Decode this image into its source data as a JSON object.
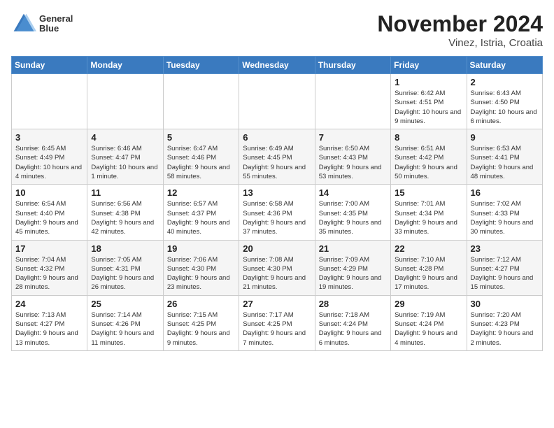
{
  "header": {
    "logo_line1": "General",
    "logo_line2": "Blue",
    "title": "November 2024",
    "subtitle": "Vinez, Istria, Croatia"
  },
  "weekdays": [
    "Sunday",
    "Monday",
    "Tuesday",
    "Wednesday",
    "Thursday",
    "Friday",
    "Saturday"
  ],
  "weeks": [
    [
      {
        "day": "",
        "info": ""
      },
      {
        "day": "",
        "info": ""
      },
      {
        "day": "",
        "info": ""
      },
      {
        "day": "",
        "info": ""
      },
      {
        "day": "",
        "info": ""
      },
      {
        "day": "1",
        "info": "Sunrise: 6:42 AM\nSunset: 4:51 PM\nDaylight: 10 hours and 9 minutes."
      },
      {
        "day": "2",
        "info": "Sunrise: 6:43 AM\nSunset: 4:50 PM\nDaylight: 10 hours and 6 minutes."
      }
    ],
    [
      {
        "day": "3",
        "info": "Sunrise: 6:45 AM\nSunset: 4:49 PM\nDaylight: 10 hours and 4 minutes."
      },
      {
        "day": "4",
        "info": "Sunrise: 6:46 AM\nSunset: 4:47 PM\nDaylight: 10 hours and 1 minute."
      },
      {
        "day": "5",
        "info": "Sunrise: 6:47 AM\nSunset: 4:46 PM\nDaylight: 9 hours and 58 minutes."
      },
      {
        "day": "6",
        "info": "Sunrise: 6:49 AM\nSunset: 4:45 PM\nDaylight: 9 hours and 55 minutes."
      },
      {
        "day": "7",
        "info": "Sunrise: 6:50 AM\nSunset: 4:43 PM\nDaylight: 9 hours and 53 minutes."
      },
      {
        "day": "8",
        "info": "Sunrise: 6:51 AM\nSunset: 4:42 PM\nDaylight: 9 hours and 50 minutes."
      },
      {
        "day": "9",
        "info": "Sunrise: 6:53 AM\nSunset: 4:41 PM\nDaylight: 9 hours and 48 minutes."
      }
    ],
    [
      {
        "day": "10",
        "info": "Sunrise: 6:54 AM\nSunset: 4:40 PM\nDaylight: 9 hours and 45 minutes."
      },
      {
        "day": "11",
        "info": "Sunrise: 6:56 AM\nSunset: 4:38 PM\nDaylight: 9 hours and 42 minutes."
      },
      {
        "day": "12",
        "info": "Sunrise: 6:57 AM\nSunset: 4:37 PM\nDaylight: 9 hours and 40 minutes."
      },
      {
        "day": "13",
        "info": "Sunrise: 6:58 AM\nSunset: 4:36 PM\nDaylight: 9 hours and 37 minutes."
      },
      {
        "day": "14",
        "info": "Sunrise: 7:00 AM\nSunset: 4:35 PM\nDaylight: 9 hours and 35 minutes."
      },
      {
        "day": "15",
        "info": "Sunrise: 7:01 AM\nSunset: 4:34 PM\nDaylight: 9 hours and 33 minutes."
      },
      {
        "day": "16",
        "info": "Sunrise: 7:02 AM\nSunset: 4:33 PM\nDaylight: 9 hours and 30 minutes."
      }
    ],
    [
      {
        "day": "17",
        "info": "Sunrise: 7:04 AM\nSunset: 4:32 PM\nDaylight: 9 hours and 28 minutes."
      },
      {
        "day": "18",
        "info": "Sunrise: 7:05 AM\nSunset: 4:31 PM\nDaylight: 9 hours and 26 minutes."
      },
      {
        "day": "19",
        "info": "Sunrise: 7:06 AM\nSunset: 4:30 PM\nDaylight: 9 hours and 23 minutes."
      },
      {
        "day": "20",
        "info": "Sunrise: 7:08 AM\nSunset: 4:30 PM\nDaylight: 9 hours and 21 minutes."
      },
      {
        "day": "21",
        "info": "Sunrise: 7:09 AM\nSunset: 4:29 PM\nDaylight: 9 hours and 19 minutes."
      },
      {
        "day": "22",
        "info": "Sunrise: 7:10 AM\nSunset: 4:28 PM\nDaylight: 9 hours and 17 minutes."
      },
      {
        "day": "23",
        "info": "Sunrise: 7:12 AM\nSunset: 4:27 PM\nDaylight: 9 hours and 15 minutes."
      }
    ],
    [
      {
        "day": "24",
        "info": "Sunrise: 7:13 AM\nSunset: 4:27 PM\nDaylight: 9 hours and 13 minutes."
      },
      {
        "day": "25",
        "info": "Sunrise: 7:14 AM\nSunset: 4:26 PM\nDaylight: 9 hours and 11 minutes."
      },
      {
        "day": "26",
        "info": "Sunrise: 7:15 AM\nSunset: 4:25 PM\nDaylight: 9 hours and 9 minutes."
      },
      {
        "day": "27",
        "info": "Sunrise: 7:17 AM\nSunset: 4:25 PM\nDaylight: 9 hours and 7 minutes."
      },
      {
        "day": "28",
        "info": "Sunrise: 7:18 AM\nSunset: 4:24 PM\nDaylight: 9 hours and 6 minutes."
      },
      {
        "day": "29",
        "info": "Sunrise: 7:19 AM\nSunset: 4:24 PM\nDaylight: 9 hours and 4 minutes."
      },
      {
        "day": "30",
        "info": "Sunrise: 7:20 AM\nSunset: 4:23 PM\nDaylight: 9 hours and 2 minutes."
      }
    ]
  ]
}
